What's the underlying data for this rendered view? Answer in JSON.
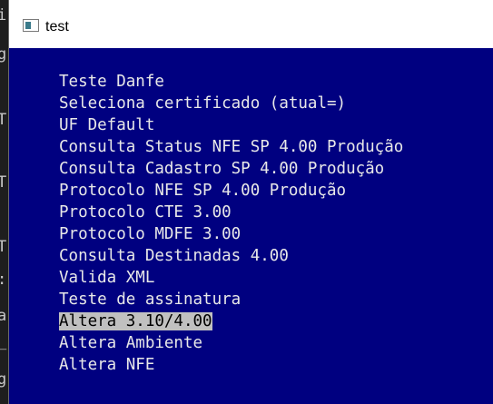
{
  "window": {
    "title": "test",
    "icon": "console-window-icon"
  },
  "background_window": {
    "glyphs": [
      "i",
      "g",
      "T",
      "T",
      "T",
      ":",
      "a",
      "_",
      "g"
    ]
  },
  "menu": {
    "items": [
      {
        "label": "Teste Danfe"
      },
      {
        "label": "Seleciona certificado (atual=)"
      },
      {
        "label": "UF Default"
      },
      {
        "label": "Consulta Status NFE SP 4.00 Produção"
      },
      {
        "label": "Consulta Cadastro SP 4.00 Produção"
      },
      {
        "label": "Protocolo NFE SP 4.00 Produção"
      },
      {
        "label": "Protocolo CTE 3.00"
      },
      {
        "label": "Protocolo MDFE 3.00"
      },
      {
        "label": "Consulta Destinadas 4.00"
      },
      {
        "label": "Valida XML"
      },
      {
        "label": "Teste de assinatura"
      },
      {
        "label": "Altera 3.10/4.00"
      },
      {
        "label": "Altera Ambiente"
      },
      {
        "label": "Altera NFE"
      }
    ],
    "selected_label": "Altera 3.10/4.00"
  },
  "colors": {
    "console_background": "#000080",
    "menu_text": "#e8e8e8",
    "selection_background": "#c0c0c0",
    "selection_text": "#000000"
  }
}
